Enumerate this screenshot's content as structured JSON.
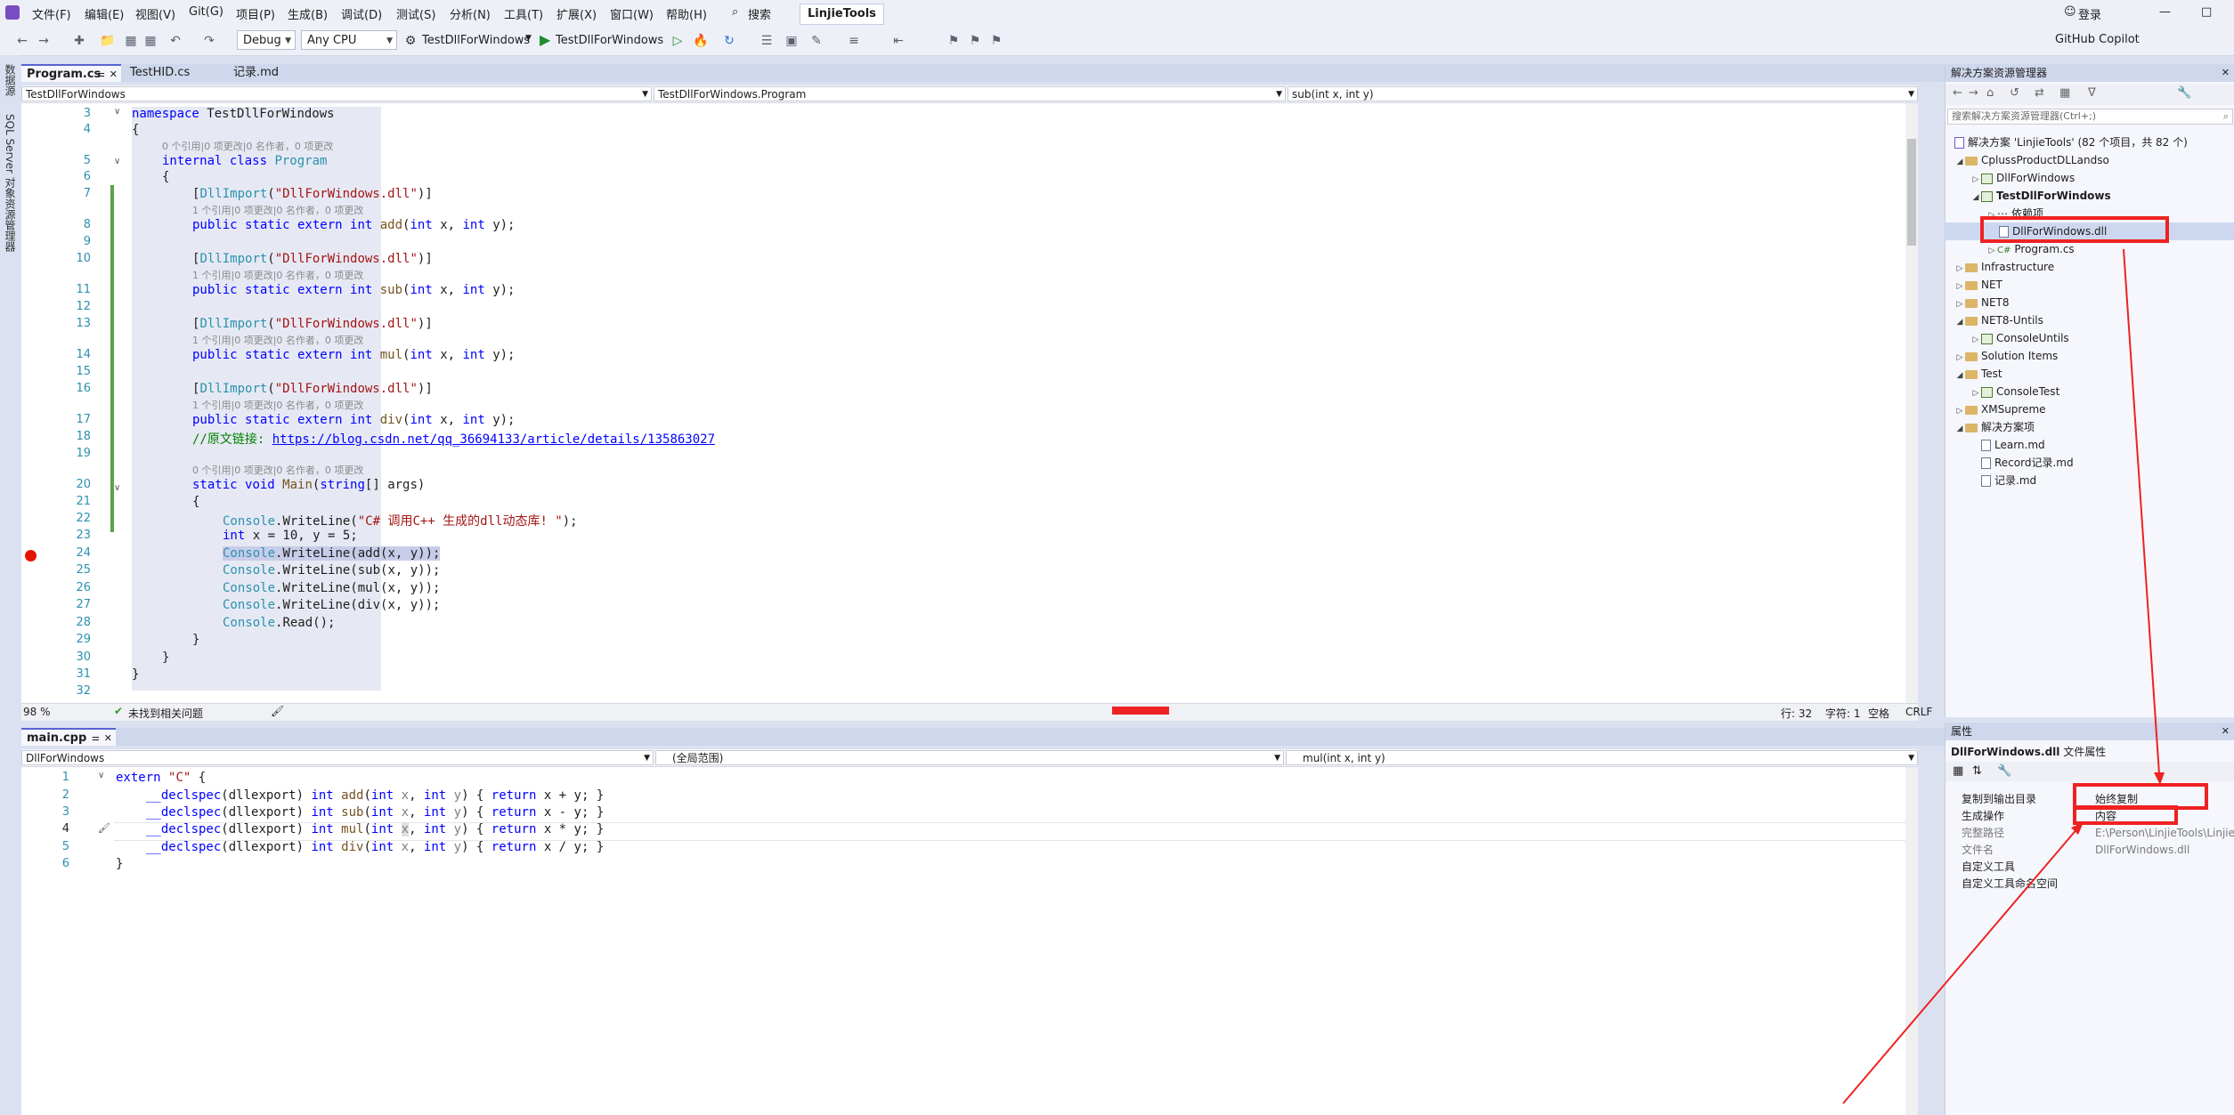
{
  "menubar": {
    "items": [
      "文件(F)",
      "编辑(E)",
      "视图(V)",
      "Git(G)",
      "项目(P)",
      "生成(B)",
      "调试(D)",
      "测试(S)",
      "分析(N)",
      "工具(T)",
      "扩展(X)",
      "窗口(W)",
      "帮助(H)"
    ],
    "search_label": "搜索",
    "solution_name": "LinjieTools",
    "login": "登录",
    "copilot": "GitHub Copilot"
  },
  "toolbar": {
    "config": "Debug",
    "platform": "Any CPU",
    "startup_project": "TestDllForWindows",
    "run_label": "TestDllForWindows"
  },
  "left_strip": {
    "items": [
      "数据源",
      "SQL Server 对象资源管理器"
    ]
  },
  "top_editor": {
    "tabs": [
      "Program.cs",
      "TestHID.cs",
      "记录.md"
    ],
    "nav": {
      "project": "TestDllForWindows",
      "class": "TestDllForWindows.Program",
      "member": "sub(int x, int y)"
    },
    "lens_a": "0 个引用|0 项更改|0 名作者，0 项更改",
    "lens_b": "1 个引用|0 项更改|0 名作者，0 项更改",
    "line_numbers": [
      "3",
      "4",
      "",
      "5",
      "6",
      "7",
      "",
      "8",
      "9",
      "10",
      "",
      "11",
      "12",
      "13",
      "",
      "14",
      "15",
      "16",
      "",
      "17",
      "18",
      "19",
      "",
      "20",
      "21",
      "22",
      "23",
      "24",
      "25",
      "26",
      "27",
      "28",
      "29",
      "30",
      "31",
      "32"
    ],
    "code": {
      "l3a": "namespace ",
      "l3b": "TestDllForWindows",
      "l4": "{",
      "l5a": "internal ",
      "l5b": "class ",
      "l5c": "Program",
      "l6": "{",
      "attr_open": "[",
      "attr_name": "DllImport",
      "attr_paren": "(",
      "attr_str": "\"DllForWindows.dll\"",
      "attr_close": ")]",
      "decl_prefix": "public static extern ",
      "decl_int": "int ",
      "fn_add": "add",
      "fn_sub": "sub",
      "fn_mul": "mul",
      "fn_div": "div",
      "params_open": "(",
      "params_int1": "int ",
      "params_x": "x, ",
      "params_int2": "int ",
      "params_y": "y);",
      "l18_cm": "//原文链接: ",
      "l18_url": "https://blog.csdn.net/qq_36694133/article/details/135863027",
      "l20a": "static ",
      "l20b": "void ",
      "l20c": "Main",
      "l20d": "(",
      "l20e": "string",
      "l20f": "[] args)",
      "l21": "{",
      "console": "Console",
      "writeline": ".WriteLine(",
      "l22_str": "\"C# 调用C++ 生成的dll动态库! \"",
      "l22_end": ");",
      "l23a": "int ",
      "l23b": "x = 10, y = 5;",
      "l24_rest": "add(x, y));",
      "l25_rest": "sub(x, y));",
      "l26_rest": "mul(x, y));",
      "l27_rest": "div(x, y));",
      "l28_rest": ".Read();",
      "l29": "}",
      "l30": "}",
      "l31": "}"
    },
    "zoom": "98 %",
    "status_issues": "未找到相关问题",
    "status_pos": "行: 32",
    "status_char": "字符: 1",
    "status_ws": "空格",
    "status_eol": "CRLF"
  },
  "bottom_editor": {
    "tab": "main.cpp",
    "nav": {
      "project": "DllForWindows",
      "scope": "(全局范围)",
      "member": "mul(int x, int y)"
    },
    "line_numbers": [
      "1",
      "2",
      "3",
      "4",
      "5",
      "6"
    ],
    "code": {
      "l1a": "extern ",
      "l1b": "\"C\"",
      "l1c": " {",
      "decl": "__declspec",
      "dllexport": "(dllexport) ",
      "int": "int ",
      "add": "add",
      "sub": "sub",
      "mul": "mul",
      "div": "div",
      "paren": "(",
      "intx": "int ",
      "x": "x",
      "comma": ", ",
      "inty": "int ",
      "y": "y",
      "close": ") { ",
      "ret": "return ",
      "op_add": "x + y; }",
      "op_sub": "x - y; }",
      "op_mul": "x * y; }",
      "op_div": "x / y; }",
      "l6": "}"
    }
  },
  "solution_explorer": {
    "title": "解决方案资源管理器",
    "search_placeholder": "搜索解决方案资源管理器(Ctrl+;)",
    "items": [
      "解决方案 'LinjieTools' (82 个项目，共 82 个)",
      "CplussProductDLLandso",
      "DllForWindows",
      "TestDllForWindows",
      "依赖项",
      "DllForWindows.dll",
      "Program.cs",
      "Infrastructure",
      "NET",
      "NET8",
      "NET8-Untils",
      "ConsoleUntils",
      "Solution Items",
      "Test",
      "ConsoleTest",
      "XMSupreme",
      "解决方案项",
      "Learn.md",
      "Record记录.md",
      "记录.md"
    ]
  },
  "properties": {
    "title": "属性",
    "subject": "DllForWindows.dll",
    "subject_type": "文件属性",
    "rows": [
      {
        "name": "复制到输出目录",
        "value": "始终复制"
      },
      {
        "name": "生成操作",
        "value": "内容"
      },
      {
        "name": "完整路径",
        "value": "E:\\Person\\LinjieTools\\Linjie"
      },
      {
        "name": "文件名",
        "value": "DllForWindows.dll"
      },
      {
        "name": "自定义工具",
        "value": ""
      },
      {
        "name": "自定义工具命名空间",
        "value": ""
      }
    ]
  },
  "colors": {
    "accent": "#5664d2",
    "highlight_box": "#ee2222",
    "breakpoint": "#e51400"
  }
}
